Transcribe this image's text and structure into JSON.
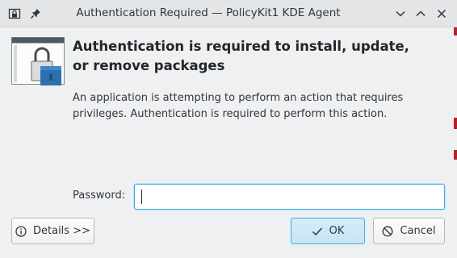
{
  "window": {
    "title": "Authentication Required — PolicyKit1 KDE Agent",
    "icons": [
      "app-lock-icon",
      "pin-icon"
    ],
    "controls": [
      "chevron-down-icon",
      "chevron-up-icon",
      "close-icon"
    ]
  },
  "dialog": {
    "heading": "Authentication is required to install, update, or remove packages",
    "description": "An application is attempting to perform an action that requires privileges. Authentication is required to perform this action.",
    "password_label": "Password:",
    "password_value": ""
  },
  "buttons": {
    "details": "Details >>",
    "ok": "OK",
    "cancel": "Cancel"
  },
  "colors": {
    "accent": "#3daee9",
    "window_bg": "#eff0f1",
    "titlebar_bg": "#e3e5e7",
    "text": "#31363b"
  }
}
